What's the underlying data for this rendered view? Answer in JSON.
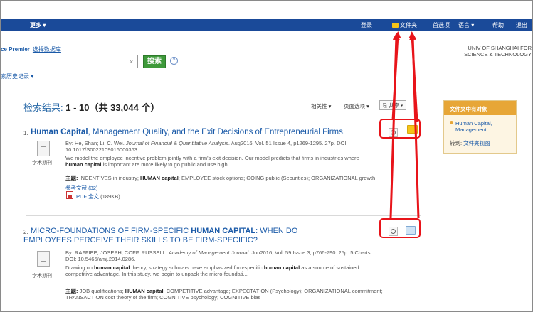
{
  "topbar": {
    "more": "更多 ▾",
    "login": "登录",
    "folder": "文件夹",
    "preferences": "首选项",
    "language": "语言 ▾",
    "help": "帮助",
    "exit": "退出"
  },
  "header": {
    "db_name": "ce Premier",
    "select_db": "选择数据库",
    "search_value": "",
    "clear": "×",
    "search_button": "搜索",
    "help": "?",
    "history": "索历史记录 ▾",
    "org_line1": "UNIV OF SHANGHAI FOR",
    "org_line2": "SCIENCE & TECHNOLOGY"
  },
  "results": {
    "label": "检索结果: ",
    "range": "1 - 10（共 33,044 个）",
    "relevance": "相关性 ▾",
    "page_options": "页面选项 ▾",
    "share": "共享 ▾"
  },
  "sidebar": {
    "title": "文件夹中有对象",
    "item_line1": "Human Capital,",
    "item_line2": "Management...",
    "goto_prefix": "转到: ",
    "goto_link": "文件夹视图"
  },
  "records": [
    {
      "num": "1.",
      "title_a": "Human Capital",
      "title_b": ", Management Quality, and the Exit Decisions of Entrepreneurial Firms.",
      "byline_pre": "By: He, Shan; Li, C. Wei. ",
      "journal": "Journal of Financial & Quantitative Analysis",
      "byline_post": ". Aug2016, Vol. 51 Issue 4, p1269-1295. 27p. DOI:",
      "doi": "10.1017/S0022109016000363.",
      "abstract1": "We model the employee incentive problem jointly with a firm's exit decision. Our model predicts that firms in industries where",
      "abstract2_bold": "human capital",
      "abstract2": " is important are more likely to go public and use high...",
      "subjects_label": "主题:",
      "subjects_a": " INCENTIVES in industry; ",
      "subjects_b": "HUMAN capital",
      "subjects_c": "; EMPLOYEE stock options; GOING public (Securities); ORGANIZATIONAL growth",
      "refs": "参考文献 (32)",
      "pdf": "PDF 全文",
      "pdf_size": " (189KB)",
      "type": "学术期刊"
    },
    {
      "num": "2.",
      "title_l1a": "MICRO-FOUNDATIONS OF FIRM-SPECIFIC ",
      "title_l1b": "HUMAN CAPITAL",
      "title_l1c": ": WHEN DO",
      "title_l2": "EMPLOYEES PERCEIVE THEIR SKILLS TO BE FIRM-SPECIFIC?",
      "byline_pre": "By: RAFFIEE, JOSEPH; COFF, RUSSELL. ",
      "journal": "Academy of Management Journal",
      "byline_post": ". Jun2016, Vol. 59 Issue 3, p766-790. 25p. 5 Charts.",
      "doi": "DOI: 10.5465/amj.2014.0286.",
      "abstract1_a": "Drawing on ",
      "abstract1_b": "human capital",
      "abstract1_c": " theory, strategy scholars have emphasized firm-specific ",
      "abstract1_d": "human capital",
      "abstract1_e": " as a source of sustained",
      "abstract2": "competitive advantage. In this study, we begin to unpack the micro-foundati...",
      "subjects_label": "主题:",
      "subjects_a": " JOB qualifications; ",
      "subjects_b": "HUMAN capital",
      "subjects_c": "; COMPETITIVE advantage; EXPECTATION (Psychology); ORGANIZATIONAL commitment;",
      "subjects_2": "TRANSACTION cost theory of the firm; COGNITIVE psychology; COGNITIVE bias",
      "type": "学术期刊"
    }
  ]
}
